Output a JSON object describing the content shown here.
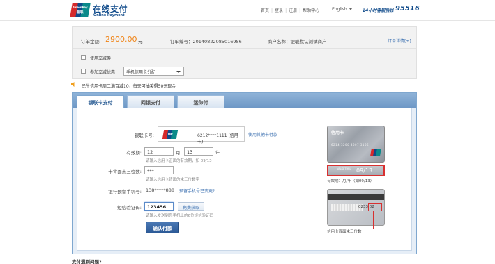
{
  "header": {
    "logo_text_top": "UnionPay",
    "logo_text_bottom": "银联",
    "brand_cn": "在线支付",
    "brand_en": "Online Payment",
    "nav": [
      "首页",
      "登录",
      "注册",
      "帮助中心"
    ],
    "language": "English",
    "hotline_label": "24小时客服热线",
    "hotline_number": "95516"
  },
  "order": {
    "amount_label": "订单金额:",
    "amount_value": "2900.00",
    "amount_unit": "元",
    "order_no": "订单编号：20140822085016986",
    "merchant": "商户名称：银联默认测试商户",
    "detail_link": "订单详情[+]",
    "coupon_label": "使用立减券",
    "discount_label": "参加立减优惠",
    "discount_select": "手机信用卡分配"
  },
  "notice": {
    "text": "民生信用卡周二满百减10，每天可抽奖得50元现金"
  },
  "tabs": [
    {
      "label": "银联卡支付"
    },
    {
      "label": "网银支付"
    },
    {
      "label": "迷你付"
    }
  ],
  "form": {
    "card_label": "银联卡号:",
    "card_logo_text": "银联",
    "card_number": "6212****1111 (信用卡)",
    "other_card_link": "使用其他卡付款",
    "expiry_label": "有效期:",
    "expiry_month": "12",
    "month_unit": "月",
    "expiry_year": "13",
    "year_unit": "年",
    "expiry_hint": "请输入信用卡正面的有效期，如 09/13",
    "cvv_label": "卡背面末三位数:",
    "cvv_value": "***",
    "cvv_hint": "请输入信用卡背面的末三位数字",
    "phone_label": "银行预留手机号:",
    "phone_value": "138*****888",
    "phone_change_link": "预留手机号已变更?",
    "sms_label": "短信验证码:",
    "sms_value": "123456",
    "sms_button": "免费获取",
    "sms_hint": "请输入发送到您手机上的6位短信验证码",
    "confirm_button": "确认付款"
  },
  "card_illustration": {
    "front_title": "信用卡",
    "front_number": "6214 3200 4007 3106",
    "valid_thru": "VALID THRU",
    "valid_date": "09/13",
    "caption_front": "有效期：月/年（如09/13）",
    "back_cvv": "0233 02",
    "caption_back": "信用卡背面末三位数"
  },
  "footer": {
    "question": "支付遇到问题?"
  }
}
